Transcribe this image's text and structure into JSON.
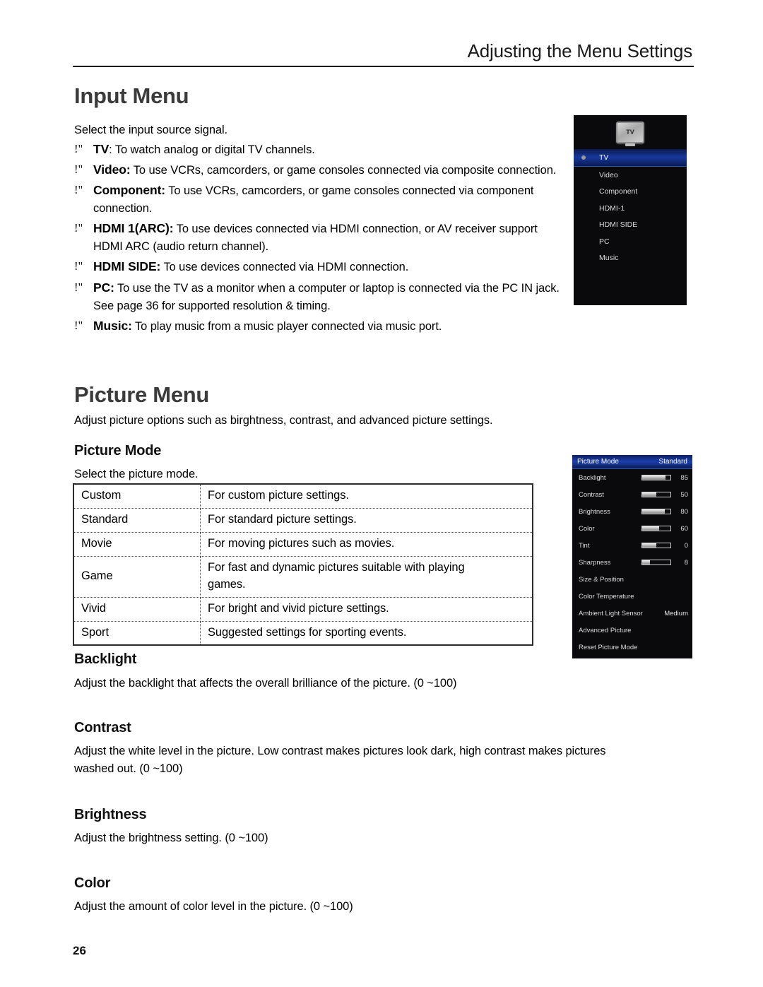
{
  "header": {
    "title": "Adjusting the Menu Settings"
  },
  "input_menu": {
    "heading": "Input Menu",
    "intro": "Select the input source signal.",
    "bullet_mark": "!\"",
    "items": [
      {
        "term": "TV",
        "separator": ":",
        "desc": " To watch analog or digital TV channels."
      },
      {
        "term": "Video:",
        "separator": "",
        "desc": " To use VCRs, camcorders, or game consoles connected via composite connection."
      },
      {
        "term": "Component:",
        "separator": "",
        "desc": " To use VCRs, camcorders, or game consoles connected via component connection."
      },
      {
        "term": "HDMI 1(ARC):",
        "separator": "",
        "desc": " To use devices connected via HDMI connection, or AV receiver support HDMI ARC (audio return channel)."
      },
      {
        "term": "HDMI SIDE:",
        "separator": "",
        "desc": " To use devices connected via HDMI connection."
      },
      {
        "term": "PC:",
        "separator": "",
        "desc": " To use the TV as a monitor when a computer or laptop is connected via the PC IN jack. See page 36 for supported resolution & timing."
      },
      {
        "term": "Music:",
        "separator": "",
        "desc": " To play music from a music player connected via music port."
      }
    ]
  },
  "input_osd": {
    "icon_label": "TV",
    "selected_index": 0,
    "items": [
      {
        "label": "TV"
      },
      {
        "label": "Video"
      },
      {
        "label": "Component"
      },
      {
        "label": "HDMI-1"
      },
      {
        "label": "HDMI SIDE"
      },
      {
        "label": "PC"
      },
      {
        "label": "Music"
      }
    ],
    "highlight_color": "#17379c",
    "background_color": "#0a0a0c"
  },
  "picture_menu": {
    "heading": "Picture Menu",
    "intro": "Adjust picture options such as birghtness, contrast, and advanced picture settings.",
    "picture_mode": {
      "heading": "Picture Mode",
      "intro": "Select the picture mode.",
      "rows": [
        {
          "mode": "Custom",
          "desc": "For custom picture settings."
        },
        {
          "mode": "Standard",
          "desc": "For standard picture settings."
        },
        {
          "mode": "Movie",
          "desc": "For moving pictures such as movies."
        },
        {
          "mode": "Game",
          "desc": "For fast and dynamic pictures suitable with playing games."
        },
        {
          "mode": "Vivid",
          "desc": "For bright and vivid picture settings."
        },
        {
          "mode": "Sport",
          "desc": "Suggested settings for sporting events."
        }
      ]
    },
    "sections": [
      {
        "heading": "Backlight",
        "text": "Adjust the backlight that affects the overall brilliance of the picture. (0 ~100)"
      },
      {
        "heading": "Contrast",
        "text": "Adjust the white level in the picture. Low contrast makes pictures look dark, high contrast makes pictures washed out. (0 ~100)"
      },
      {
        "heading": "Brightness",
        "text": "Adjust the brightness setting. (0 ~100)"
      },
      {
        "heading": "Color",
        "text": "Adjust the amount of color level in the picture. (0 ~100)"
      }
    ]
  },
  "picture_osd": {
    "title": "Picture Mode",
    "title_value": "Standard",
    "rows": [
      {
        "label": "Backlight",
        "type": "slider",
        "value": "85",
        "fill": 83
      },
      {
        "label": "Contrast",
        "type": "slider",
        "value": "50",
        "fill": 50
      },
      {
        "label": "Brightness",
        "type": "slider",
        "value": "80",
        "fill": 80
      },
      {
        "label": "Color",
        "type": "slider",
        "value": "60",
        "fill": 60
      },
      {
        "label": "Tint",
        "type": "slider",
        "value": "0",
        "fill": 50
      },
      {
        "label": "Sharpness",
        "type": "slider",
        "value": "8",
        "fill": 27
      },
      {
        "label": "Size & Position",
        "type": "plain",
        "value": ""
      },
      {
        "label": "Color Temperature",
        "type": "plain",
        "value": ""
      },
      {
        "label": "Ambient Light Sensor",
        "type": "value",
        "value": "Medium"
      },
      {
        "label": "Advanced Picture",
        "type": "plain",
        "value": ""
      },
      {
        "label": "Reset Picture Mode",
        "type": "plain",
        "value": ""
      }
    ],
    "highlight_color": "#1a3fae",
    "background_color": "#0a0a0c"
  },
  "footer": {
    "page_number": "26"
  }
}
